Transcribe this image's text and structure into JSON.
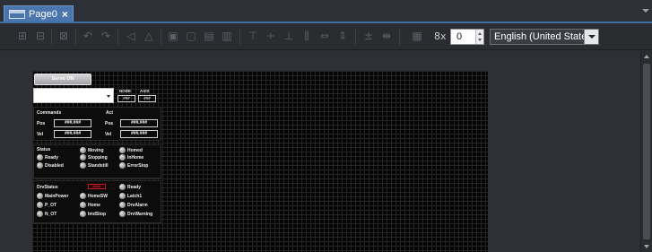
{
  "tab": {
    "title": "Page0",
    "close": "×"
  },
  "toolbar": {
    "spin_label": "8x",
    "spin_value": "0",
    "language": "English (United States)"
  },
  "panel": {
    "servo_button": "Servo ON",
    "node_label": "NODE",
    "axis_label": "AXIS",
    "node_value": "###",
    "axis_value": "###",
    "commands_label": "Commands",
    "act_label": "Act",
    "pos_label": "Pos",
    "vel_label": "Vel",
    "cmd_pos": "###.###",
    "cmd_vel": "###.###",
    "act_pos": "###.###",
    "act_vel": "###.###",
    "status_label": "Status",
    "status_items": [
      "Ready",
      "Moving",
      "Homed",
      "Disabled",
      "Stopping",
      "InHome",
      "Standstill",
      "ErrorStop"
    ],
    "drv_label": "DrvStatus",
    "drv_error": "####",
    "drv_items": [
      "Ready",
      "MainPower",
      "HomeSW",
      "Latch1",
      "P_OT",
      "Home",
      "DrvAlarm",
      "N_OT",
      "ImdStop",
      "DrvWarning"
    ]
  }
}
